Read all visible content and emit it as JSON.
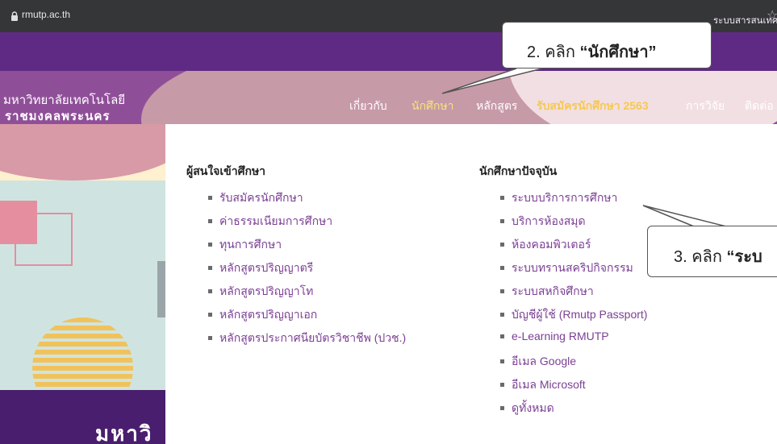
{
  "browser": {
    "url": "rmutp.ac.th"
  },
  "topbar": {
    "link_text": "ระบบสารสนเทศ"
  },
  "header": {
    "logo_line1": "มหาวิทยาลัยเทคโนโลยี",
    "logo_line2": "ราชมงคลพระนคร",
    "nav": {
      "about": "เกี่ยวกับ",
      "students": "นักศึกษา",
      "courses": "หลักสูตร",
      "admission": "รับสมัครนักศึกษา 2563",
      "research": "การวิจัย",
      "contact": "ติดต่อ"
    }
  },
  "hero": {
    "title": "มหาวิ"
  },
  "dropdown": {
    "prospective": {
      "heading": "ผู้สนใจเข้าศึกษา",
      "items": [
        "รับสมัครนักศึกษา",
        "ค่าธรรมเนียมการศึกษา",
        "ทุนการศึกษา",
        "หลักสูตรปริญญาตรี",
        "หลักสูตรปริญญาโท",
        "หลักสูตรปริญญาเอก",
        "หลักสูตรประกาศนียบัตรวิชาชีพ (ปวช.)"
      ]
    },
    "current": {
      "heading": "นักศึกษาปัจจุบัน",
      "items": [
        "ระบบบริการการศึกษา",
        "บริการห้องสมุด",
        "ห้องคอมพิวเตอร์",
        "ระบบทรานสคริปกิจกรรม",
        "ระบบสหกิจศึกษา",
        "บัญชีผู้ใช้ (Rmutp Passport)",
        "e-Learning RMUTP",
        "อีเมล Google",
        "อีเมล Microsoft",
        "ดูทั้งหมด"
      ]
    }
  },
  "callouts": {
    "step2_prefix": "2. คลิก ",
    "step2_target": "“นักศึกษา”",
    "step3_prefix": "3. คลิก ",
    "step3_target": "“ระบ"
  },
  "colors": {
    "topbar": "#5f2a83",
    "menu_link": "#7b3f94",
    "nav_active": "#f3e57a",
    "admission_highlight": "#f6c94f"
  }
}
